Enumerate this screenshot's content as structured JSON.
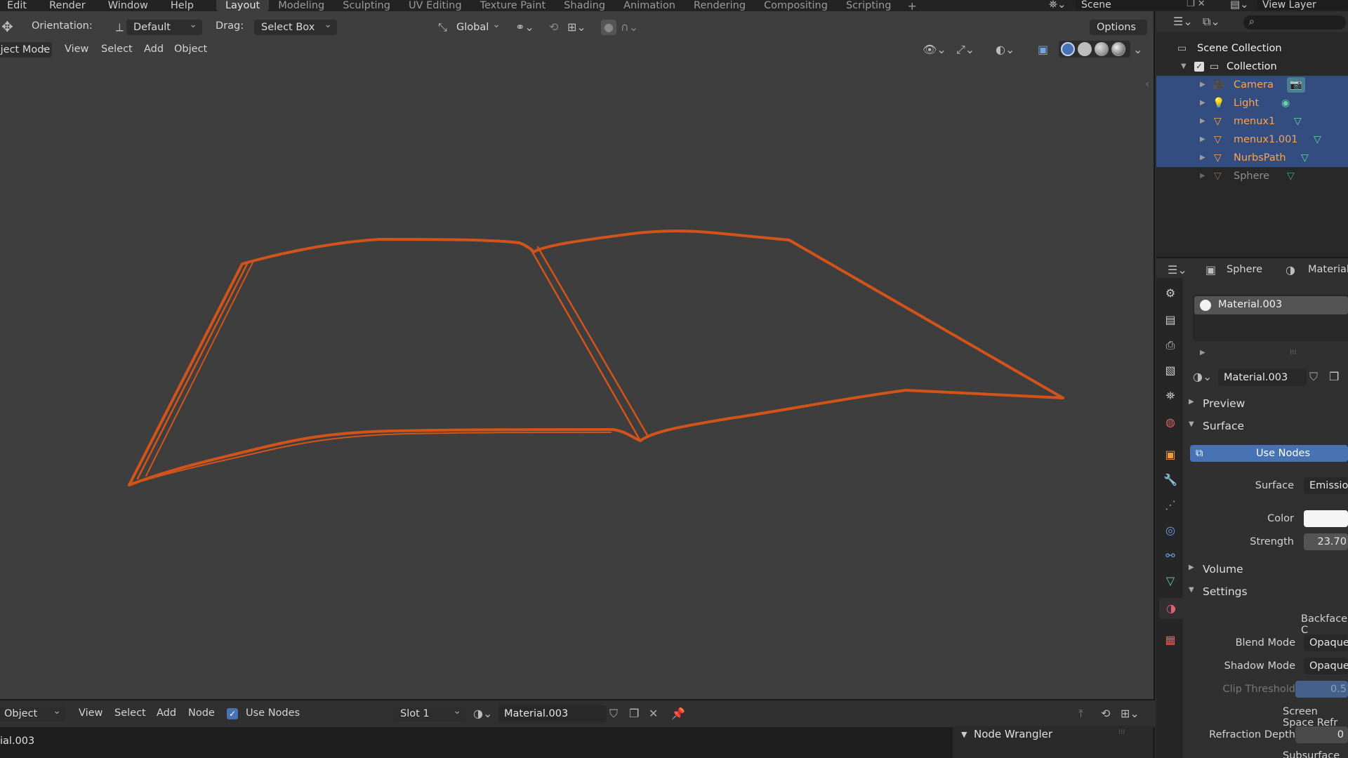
{
  "topbar": {
    "menus": [
      "Edit",
      "Render",
      "Window",
      "Help"
    ],
    "workspaces": [
      "Layout",
      "Modeling",
      "Sculpting",
      "UV Editing",
      "Texture Paint",
      "Shading",
      "Animation",
      "Rendering",
      "Compositing",
      "Scripting"
    ],
    "active_workspace": "Layout",
    "scene": "Scene",
    "view_layer": "View Layer"
  },
  "viewport": {
    "orientation_label": "Orientation:",
    "orientation_value": "Default",
    "drag_label": "Drag:",
    "drag_value": "Select Box",
    "transform_orientation": "Global",
    "options_label": "Options",
    "mode": "Object Mode",
    "menus": [
      "View",
      "Select",
      "Add",
      "Object"
    ]
  },
  "outliner": {
    "root": "Scene Collection",
    "collection": "Collection",
    "items": [
      {
        "name": "Camera",
        "icon": "camera-icon",
        "data_icon": "camera-data-icon",
        "selected": true,
        "hidden": false
      },
      {
        "name": "Light",
        "icon": "light-icon",
        "data_icon": "light-data-icon",
        "selected": true,
        "hidden": false
      },
      {
        "name": "menux1",
        "icon": "mesh-icon",
        "data_icon": "mesh-data-icon",
        "selected": true,
        "hidden": false
      },
      {
        "name": "menux1.001",
        "icon": "mesh-icon",
        "data_icon": "mesh-data-icon",
        "selected": true,
        "hidden": false
      },
      {
        "name": "NurbsPath",
        "icon": "mesh-icon",
        "data_icon": "mesh-data-icon",
        "selected": true,
        "hidden": false
      },
      {
        "name": "Sphere",
        "icon": "mesh-icon",
        "data_icon": "mesh-data-icon",
        "selected": false,
        "hidden": true
      }
    ]
  },
  "properties": {
    "object": "Sphere",
    "material_tab": "Material.",
    "slot_material": "Material.003",
    "datablock": "Material.003",
    "sections": {
      "preview": "Preview",
      "surface": "Surface",
      "volume": "Volume",
      "settings": "Settings"
    },
    "use_nodes": "Use Nodes",
    "surface_label": "Surface",
    "surface_value": "Emission",
    "color_label": "Color",
    "strength_label": "Strength",
    "strength_value": "23.70",
    "backface": "Backface C",
    "blend_mode_label": "Blend Mode",
    "blend_mode_value": "Opaque",
    "shadow_mode_label": "Shadow Mode",
    "shadow_mode_value": "Opaque",
    "clip_threshold_label": "Clip Threshold",
    "clip_threshold_value": "0.5",
    "ssr": "Screen Space Refr",
    "refraction_depth_label": "Refraction Depth",
    "refraction_depth_value": "0",
    "subsurface": "Subsurface Transl"
  },
  "node_editor": {
    "mode": "Object",
    "menus": [
      "View",
      "Select",
      "Add",
      "Node"
    ],
    "use_nodes": "Use Nodes",
    "slot": "Slot 1",
    "material": "Material.003",
    "breadcrumb": "ial.003",
    "panel": "Node Wrangler"
  },
  "colors": {
    "selection": "#334d80",
    "accent_blue": "#4772b3",
    "wire_orange": "#d2541a",
    "outliner_orange": "#ffa34a"
  }
}
